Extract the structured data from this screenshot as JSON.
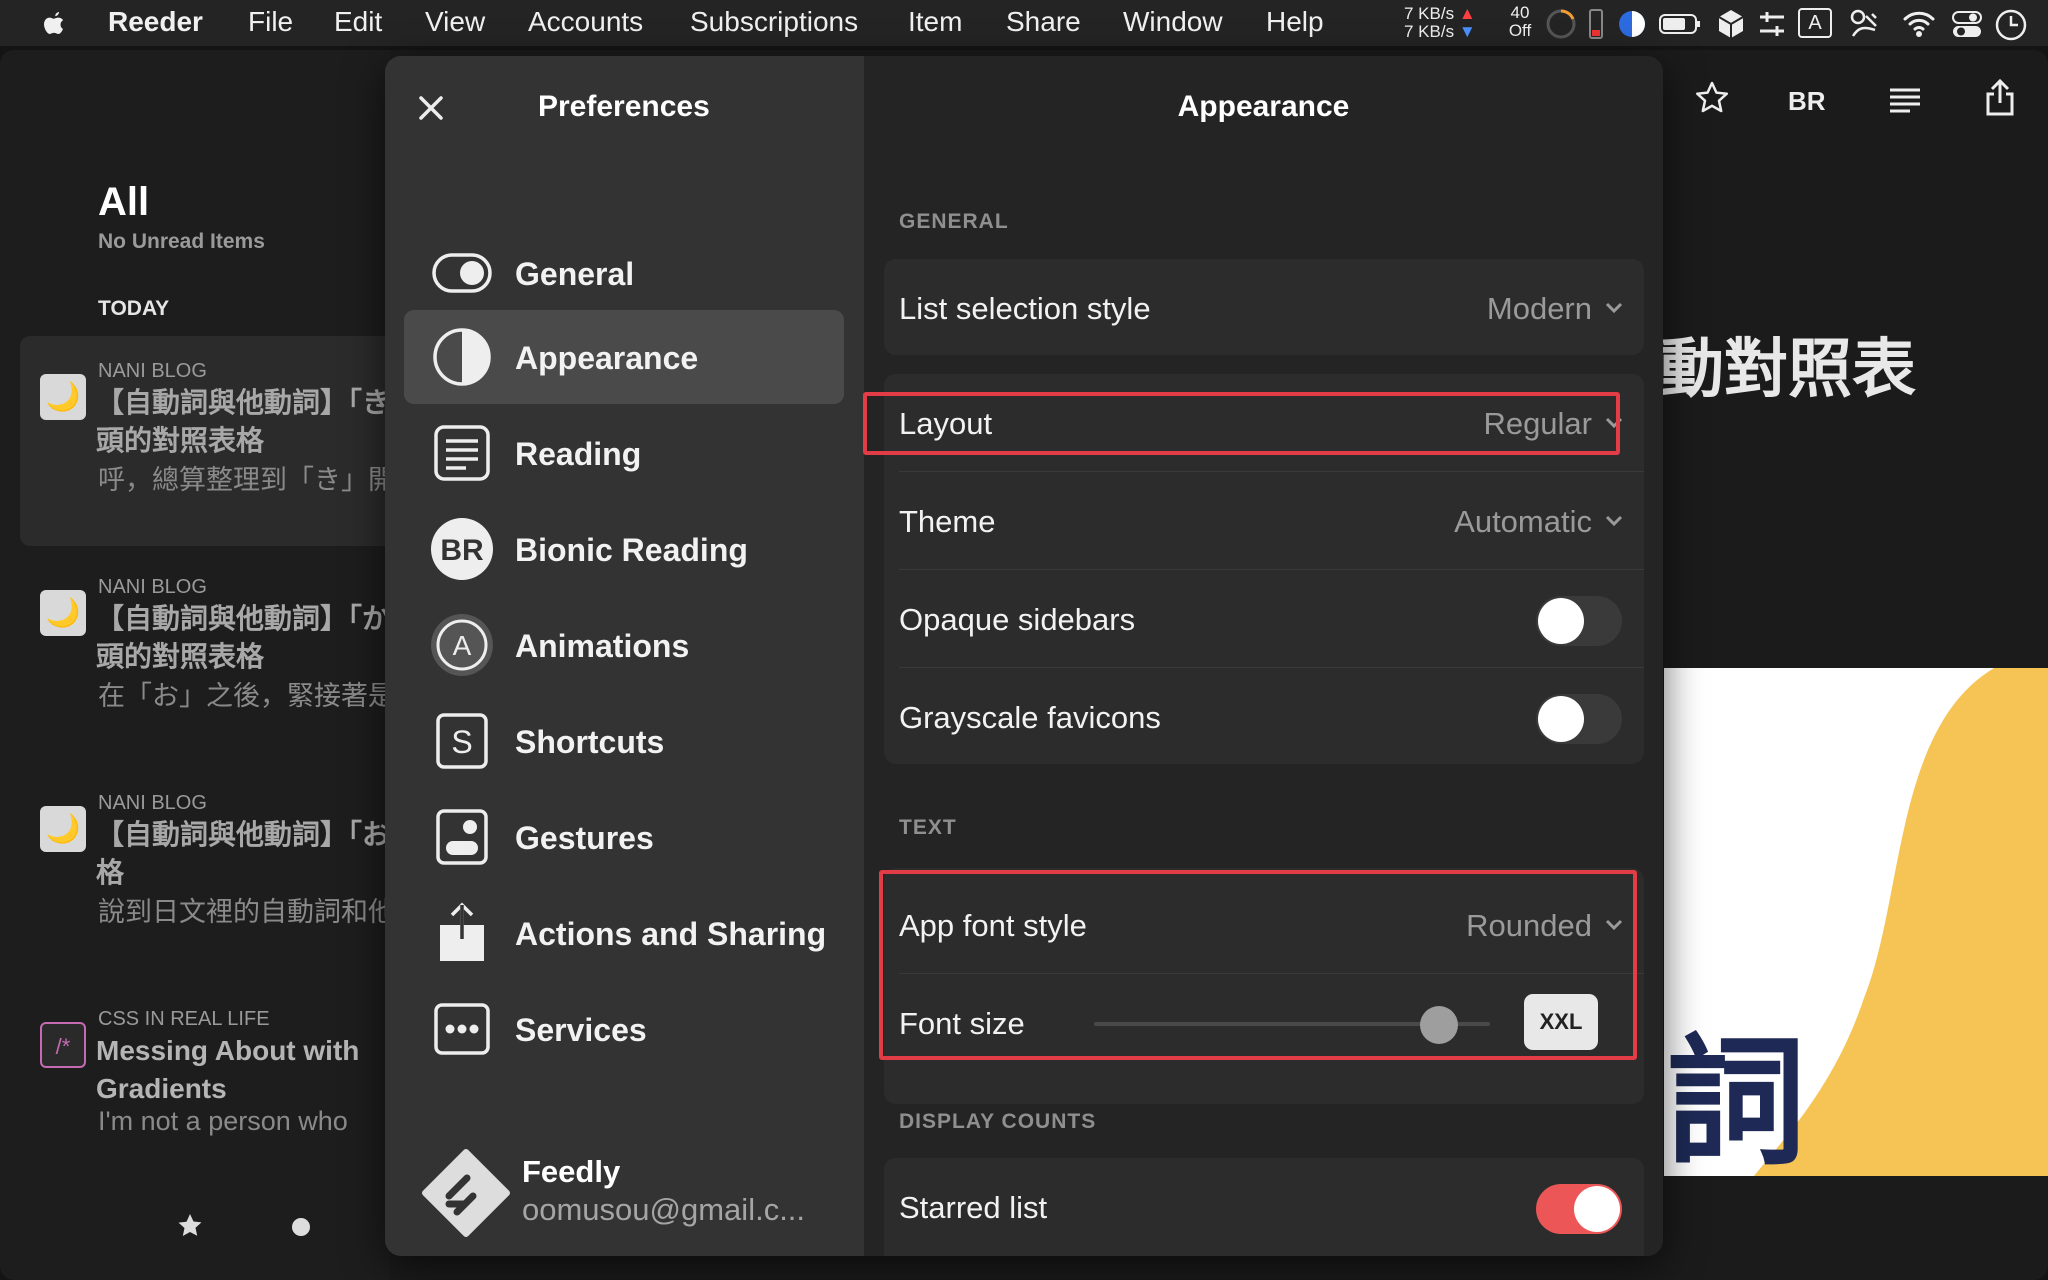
{
  "menubar": {
    "app_name": "Reeder",
    "items": [
      "File",
      "Edit",
      "View",
      "Accounts",
      "Subscriptions",
      "Item",
      "Share",
      "Window",
      "Help"
    ],
    "net_up": "7 KB/s",
    "net_down": "7 KB/s",
    "stat_top": "40",
    "stat_bottom": "Off",
    "input_letter": "A"
  },
  "list": {
    "title": "All",
    "subtitle": "No Unread Items",
    "section": "TODAY",
    "articles": [
      {
        "source": "NANI BLOG",
        "title1": "【自動詞與他動詞】「き」",
        "title2": "頭的對照表格",
        "excerpt": "呼，總算整理到「き」開",
        "favicon": "🌙"
      },
      {
        "source": "NANI BLOG",
        "title1": "【自動詞與他動詞】「か」",
        "title2": "頭的對照表格",
        "excerpt": "在「お」之後，緊接著是",
        "favicon": "🌙"
      },
      {
        "source": "NANI BLOG",
        "title1": "【自動詞與他動詞】「お」",
        "title2": "格",
        "excerpt": "說到日文裡的自動詞和他",
        "favicon": "🌙"
      },
      {
        "source": "CSS IN REAL LIFE",
        "title1": "Messing About with",
        "title2": "Gradients",
        "excerpt": "I'm not a person who",
        "favicon": "/*"
      }
    ]
  },
  "reader": {
    "title_fragment": "動對照表",
    "hero_char": "詞",
    "toolbar_br": "BR"
  },
  "prefs": {
    "sidebar_title": "Preferences",
    "items": [
      {
        "label": "General",
        "icon": "toggle-icon"
      },
      {
        "label": "Appearance",
        "icon": "half-circle-icon"
      },
      {
        "label": "Reading",
        "icon": "document-lines-icon"
      },
      {
        "label": "Bionic Reading",
        "icon": "br-icon"
      },
      {
        "label": "Animations",
        "icon": "a-circle-icon"
      },
      {
        "label": "Shortcuts",
        "icon": "s-key-icon"
      },
      {
        "label": "Gestures",
        "icon": "gestures-icon"
      },
      {
        "label": "Actions and Sharing",
        "icon": "share-icon"
      },
      {
        "label": "Services",
        "icon": "ellipsis-icon"
      }
    ],
    "account": {
      "name": "Feedly",
      "email": "oomusou@gmail.c..."
    },
    "main_title": "Appearance",
    "general_section": "GENERAL",
    "text_section": "TEXT",
    "counts_section": "DISPLAY COUNTS",
    "list_selection_style": {
      "label": "List selection style",
      "value": "Modern"
    },
    "layout": {
      "label": "Layout",
      "value": "Regular"
    },
    "theme": {
      "label": "Theme",
      "value": "Automatic"
    },
    "opaque_sidebars": {
      "label": "Opaque sidebars",
      "on": false
    },
    "grayscale_favicons": {
      "label": "Grayscale favicons",
      "on": false
    },
    "app_font_style": {
      "label": "App font style",
      "value": "Rounded"
    },
    "font_size": {
      "label": "Font size",
      "value": "XXL",
      "level": 0.87
    },
    "starred_list": {
      "label": "Starred list",
      "on": true
    }
  },
  "colors": {
    "highlight": "#e23c47",
    "toggle_on": "#ec5657",
    "hero_yellow": "#f5c454"
  }
}
